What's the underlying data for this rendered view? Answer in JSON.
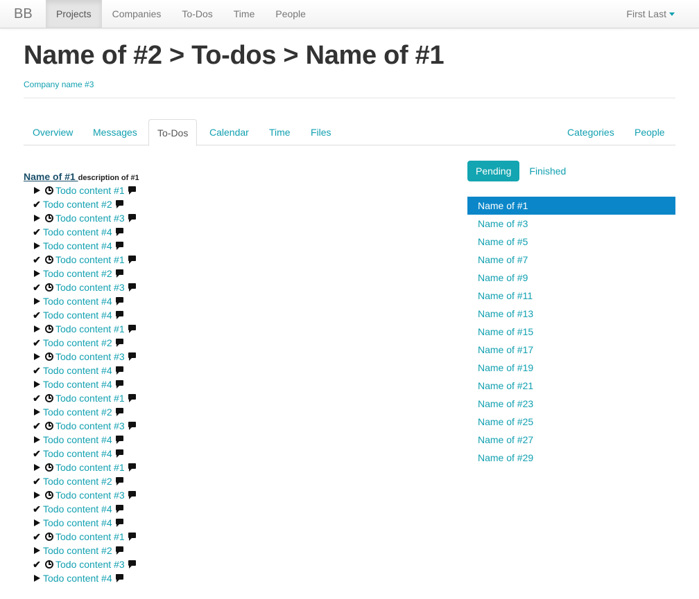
{
  "navbar": {
    "brand": "BB",
    "items": [
      {
        "label": "Projects",
        "active": true
      },
      {
        "label": "Companies",
        "active": false
      },
      {
        "label": "To-Dos",
        "active": false
      },
      {
        "label": "Time",
        "active": false
      },
      {
        "label": "People",
        "active": false
      }
    ],
    "user": "First Last"
  },
  "header": {
    "title": "Name of #2 > To-dos > Name of #1",
    "company": "Company name #3"
  },
  "tabs": {
    "left": [
      "Overview",
      "Messages",
      "To-Dos",
      "Calendar",
      "Time",
      "Files"
    ],
    "active": "To-Dos",
    "right": [
      "Categories",
      "People"
    ]
  },
  "todolist": {
    "name": "Name of #1 ",
    "description": "description of #1",
    "todos": [
      {
        "status": "arrow",
        "clock": true,
        "text": "Todo content #1"
      },
      {
        "status": "check",
        "clock": false,
        "text": "Todo content #2"
      },
      {
        "status": "arrow",
        "clock": true,
        "text": "Todo content #3"
      },
      {
        "status": "check",
        "clock": false,
        "text": "Todo content #4"
      },
      {
        "status": "arrow",
        "clock": false,
        "text": "Todo content #4"
      },
      {
        "status": "check",
        "clock": true,
        "text": "Todo content #1"
      },
      {
        "status": "arrow",
        "clock": false,
        "text": "Todo content #2"
      },
      {
        "status": "check",
        "clock": true,
        "text": "Todo content #3"
      },
      {
        "status": "arrow",
        "clock": false,
        "text": "Todo content #4"
      },
      {
        "status": "check",
        "clock": false,
        "text": "Todo content #4"
      },
      {
        "status": "arrow",
        "clock": true,
        "text": "Todo content #1"
      },
      {
        "status": "check",
        "clock": false,
        "text": "Todo content #2"
      },
      {
        "status": "arrow",
        "clock": true,
        "text": "Todo content #3"
      },
      {
        "status": "check",
        "clock": false,
        "text": "Todo content #4"
      },
      {
        "status": "arrow",
        "clock": false,
        "text": "Todo content #4"
      },
      {
        "status": "check",
        "clock": true,
        "text": "Todo content #1"
      },
      {
        "status": "arrow",
        "clock": false,
        "text": "Todo content #2"
      },
      {
        "status": "check",
        "clock": true,
        "text": "Todo content #3"
      },
      {
        "status": "arrow",
        "clock": false,
        "text": "Todo content #4"
      },
      {
        "status": "check",
        "clock": false,
        "text": "Todo content #4"
      },
      {
        "status": "arrow",
        "clock": true,
        "text": "Todo content #1"
      },
      {
        "status": "check",
        "clock": false,
        "text": "Todo content #2"
      },
      {
        "status": "arrow",
        "clock": true,
        "text": "Todo content #3"
      },
      {
        "status": "check",
        "clock": false,
        "text": "Todo content #4"
      },
      {
        "status": "arrow",
        "clock": false,
        "text": "Todo content #4"
      },
      {
        "status": "check",
        "clock": true,
        "text": "Todo content #1"
      },
      {
        "status": "arrow",
        "clock": false,
        "text": "Todo content #2"
      },
      {
        "status": "check",
        "clock": true,
        "text": "Todo content #3"
      },
      {
        "status": "arrow",
        "clock": false,
        "text": "Todo content #4"
      }
    ]
  },
  "filters": {
    "options": [
      "Pending",
      "Finished"
    ],
    "active": "Pending"
  },
  "lists": {
    "active": "Name of #1",
    "items": [
      "Name of #1",
      "Name of #3",
      "Name of #5",
      "Name of #7",
      "Name of #9",
      "Name of #11",
      "Name of #13",
      "Name of #15",
      "Name of #17",
      "Name of #19",
      "Name of #21",
      "Name of #23",
      "Name of #25",
      "Name of #27",
      "Name of #29"
    ]
  },
  "colors": {
    "link": "#11a0b0",
    "pill_active": "#13a5b1",
    "list_active": "#0b87c9",
    "list_name": "#1a4f6a"
  }
}
